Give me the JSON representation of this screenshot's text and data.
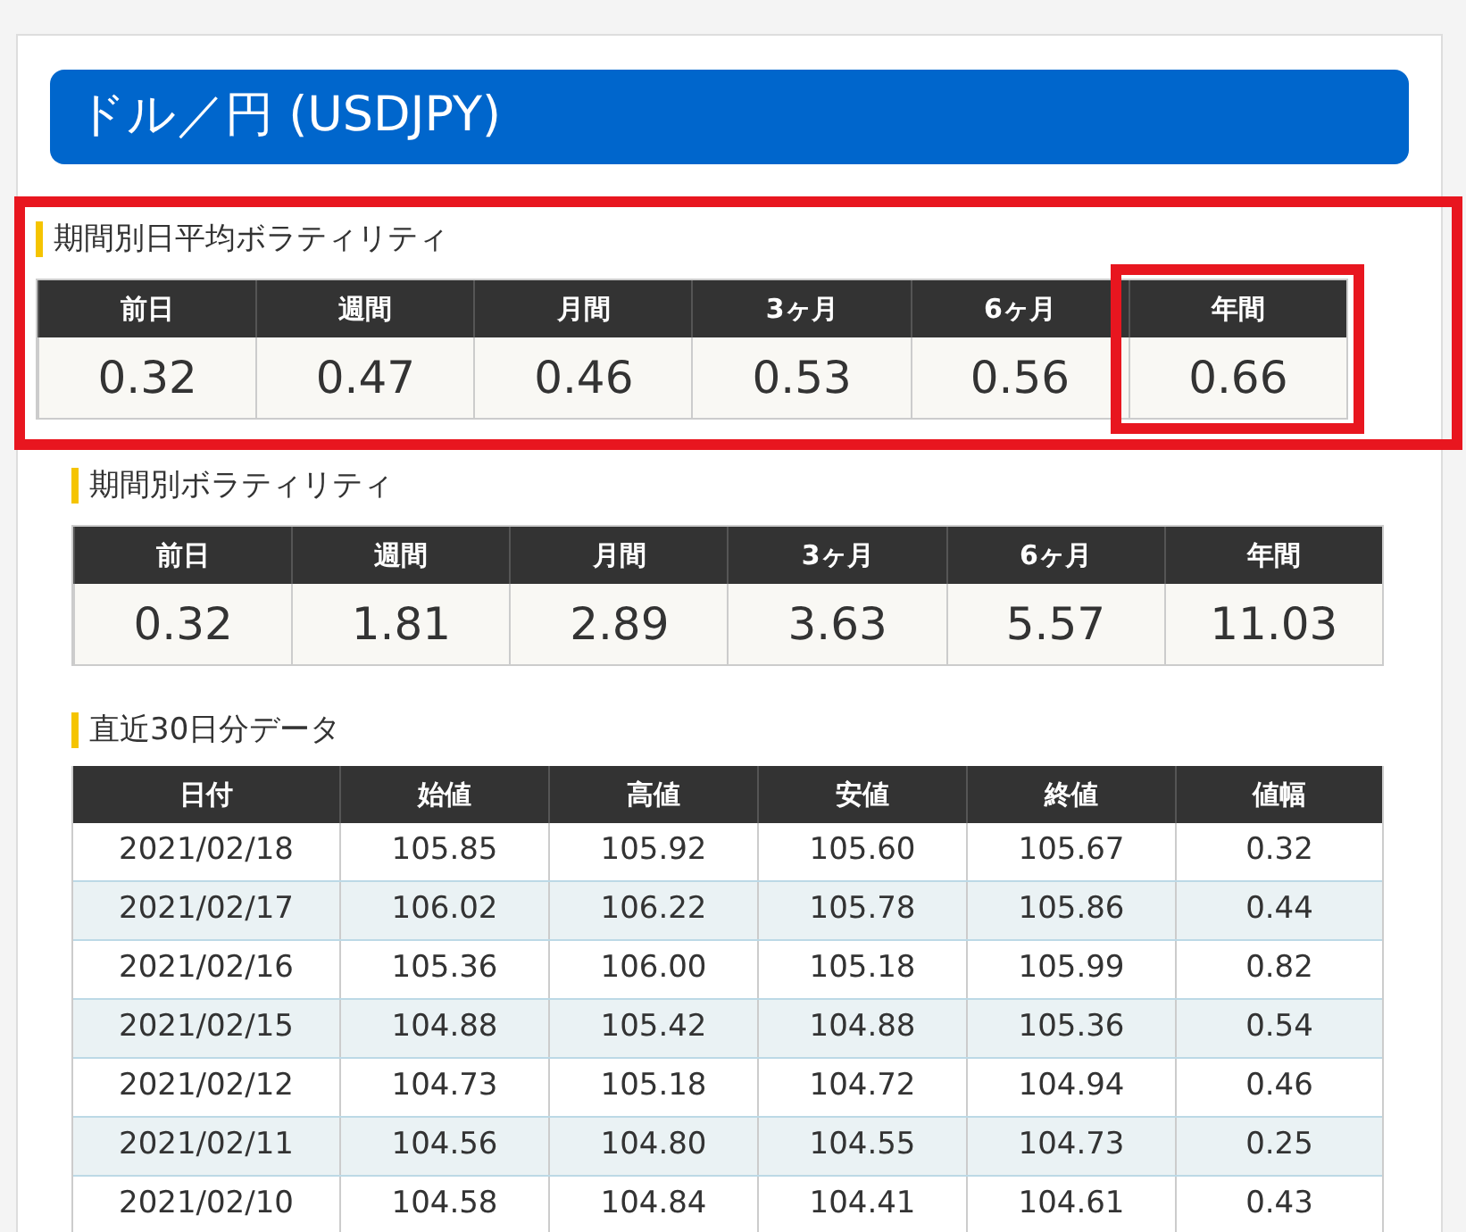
{
  "title": "ドル／円 (USDJPY)",
  "summaries": [
    {
      "heading": "期間別日平均ボラティリティ",
      "highlighted": true,
      "columns": [
        {
          "label": "前日",
          "value": "0.32",
          "highlighted": false
        },
        {
          "label": "週間",
          "value": "0.47",
          "highlighted": false
        },
        {
          "label": "月間",
          "value": "0.46",
          "highlighted": false
        },
        {
          "label": "3ヶ月",
          "value": "0.53",
          "highlighted": false
        },
        {
          "label": "6ヶ月",
          "value": "0.56",
          "highlighted": false
        },
        {
          "label": "年間",
          "value": "0.66",
          "highlighted": true
        }
      ]
    },
    {
      "heading": "期間別ボラティリティ",
      "highlighted": false,
      "columns": [
        {
          "label": "前日",
          "value": "0.32",
          "highlighted": false
        },
        {
          "label": "週間",
          "value": "1.81",
          "highlighted": false
        },
        {
          "label": "月間",
          "value": "2.89",
          "highlighted": false
        },
        {
          "label": "3ヶ月",
          "value": "3.63",
          "highlighted": false
        },
        {
          "label": "6ヶ月",
          "value": "5.57",
          "highlighted": false
        },
        {
          "label": "年間",
          "value": "11.03",
          "highlighted": false
        }
      ]
    }
  ],
  "history": {
    "heading": "直近30日分データ",
    "columns": [
      "日付",
      "始値",
      "高値",
      "安値",
      "終値",
      "値幅"
    ],
    "rows": [
      [
        "2021/02/18",
        "105.85",
        "105.92",
        "105.60",
        "105.67",
        "0.32"
      ],
      [
        "2021/02/17",
        "106.02",
        "106.22",
        "105.78",
        "105.86",
        "0.44"
      ],
      [
        "2021/02/16",
        "105.36",
        "106.00",
        "105.18",
        "105.99",
        "0.82"
      ],
      [
        "2021/02/15",
        "104.88",
        "105.42",
        "104.88",
        "105.36",
        "0.54"
      ],
      [
        "2021/02/12",
        "104.73",
        "105.18",
        "104.72",
        "104.94",
        "0.46"
      ],
      [
        "2021/02/11",
        "104.56",
        "104.80",
        "104.55",
        "104.73",
        "0.25"
      ],
      [
        "2021/02/10",
        "104.58",
        "104.84",
        "104.41",
        "104.61",
        "0.43"
      ]
    ]
  }
}
